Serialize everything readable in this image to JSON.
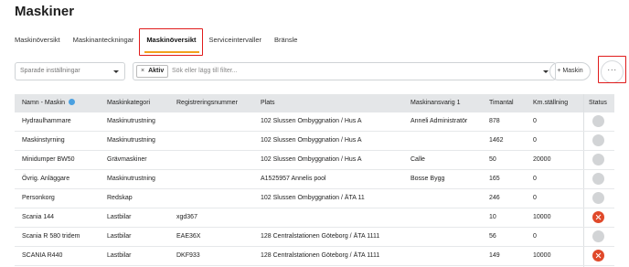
{
  "page": {
    "title": "Maskiner"
  },
  "tabs": [
    {
      "label": "Maskinöversikt"
    },
    {
      "label": "Maskinanteckningar"
    },
    {
      "label": "Maskinöversikt"
    },
    {
      "label": "Serviceintervaller"
    },
    {
      "label": "Bränsle"
    }
  ],
  "toolbar": {
    "saved_settings_placeholder": "Sparade inställningar",
    "filter_chip": "Aktiv",
    "filter_chip_remove": "×",
    "filter_placeholder": "Sök eller lägg till filter...",
    "add_machine_label": "+ Maskin",
    "more_label": "···"
  },
  "table": {
    "columns": [
      "Namn - Maskin",
      "Maskinkategori",
      "Registreringsnummer",
      "Plats",
      "Maskinansvarig 1",
      "Timantal",
      "Km.ställning",
      "Status"
    ],
    "rows": [
      {
        "name": "Hydraulhammare",
        "category": "Maskinutrustning",
        "reg": "",
        "place": "102 Slussen Ombyggnation / Hus A",
        "responsible": "Anneli Administratör",
        "hours": "878",
        "km": "0",
        "status": "inactive"
      },
      {
        "name": "Maskinstyrning",
        "category": "Maskinutrustning",
        "reg": "",
        "place": "102 Slussen Ombyggnation / Hus A",
        "responsible": "",
        "hours": "1462",
        "km": "0",
        "status": "inactive"
      },
      {
        "name": "Minidumper BW50",
        "category": "Grävmaskiner",
        "reg": "",
        "place": "102 Slussen Ombyggnation / Hus A",
        "responsible": "Calle",
        "hours": "50",
        "km": "20000",
        "status": "inactive"
      },
      {
        "name": "Övrig. Anläggare",
        "category": "Maskinutrustning",
        "reg": "",
        "place": "A1525957 Annelis pool",
        "responsible": "Bosse Bygg",
        "hours": "165",
        "km": "0",
        "status": "inactive"
      },
      {
        "name": "Personkorg",
        "category": "Redskap",
        "reg": "",
        "place": "102 Slussen Ombyggnation / ÄTA 11",
        "responsible": "",
        "hours": "246",
        "km": "0",
        "status": "inactive"
      },
      {
        "name": "Scania 144",
        "category": "Lastbilar",
        "reg": "xgd367",
        "place": "",
        "responsible": "",
        "hours": "10",
        "km": "10000",
        "status": "error"
      },
      {
        "name": "Scania R 580 tridem",
        "category": "Lastbilar",
        "reg": "EAE36X",
        "place": "128 Centralstationen Göteborg / ÄTA 1111",
        "responsible": "",
        "hours": "56",
        "km": "0",
        "status": "inactive"
      },
      {
        "name": "SCANIA R440",
        "category": "Lastbilar",
        "reg": "DKF933",
        "place": "128 Centralstationen Göteborg / ÄTA 1111",
        "responsible": "",
        "hours": "149",
        "km": "10000",
        "status": "error"
      }
    ]
  },
  "colors": {
    "accent_tab": "#f2a11c",
    "highlight": "#e01b1b",
    "status_error": "#e0492a",
    "status_inactive": "#d2d4d6",
    "sort_icon": "#4aa0e0"
  }
}
